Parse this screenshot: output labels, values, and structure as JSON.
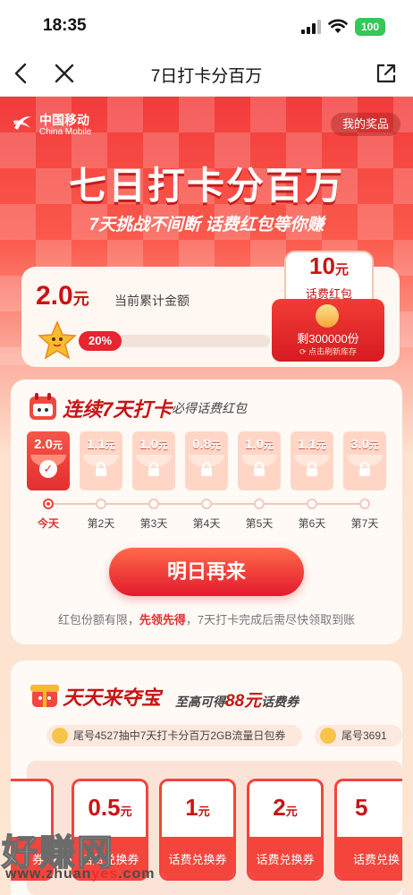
{
  "status_bar": {
    "time": "18:35",
    "battery": "100"
  },
  "nav": {
    "title": "7日打卡分百万"
  },
  "brand": {
    "cn": "中国移动",
    "en": "China Mobile"
  },
  "header": {
    "prize_link": "我的奖品",
    "title": "七日打卡分百万",
    "subtitle": "7天挑战不间断 话费红包等你赚"
  },
  "amount_card": {
    "value": "2.0",
    "unit": "元",
    "label": "当前累计金额",
    "progress_label": "20%",
    "progress_fraction": 0.2
  },
  "red_packet": {
    "value": "10",
    "unit": "元",
    "name": "话费红包",
    "remaining": "剩300000份",
    "refresh": "点击刷新库存"
  },
  "checkin": {
    "title": "连续7天打卡",
    "subtitle": "必得话费红包",
    "days": [
      {
        "value": "2.0",
        "unit": "元",
        "label": "今天",
        "done": true
      },
      {
        "value": "1.1",
        "unit": "元",
        "label": "第2天",
        "done": false
      },
      {
        "value": "1.0",
        "unit": "元",
        "label": "第3天",
        "done": false
      },
      {
        "value": "0.8",
        "unit": "元",
        "label": "第4天",
        "done": false
      },
      {
        "value": "1.0",
        "unit": "元",
        "label": "第5天",
        "done": false
      },
      {
        "value": "1.1",
        "unit": "元",
        "label": "第6天",
        "done": false
      },
      {
        "value": "3.0",
        "unit": "元",
        "label": "第7天",
        "done": false
      }
    ],
    "button": "明日再来",
    "note_prefix": "红包份额有限，",
    "note_highlight": "先领先得",
    "note_suffix": "，7天打卡完成后需尽快领取到账"
  },
  "treasure": {
    "title": "天天来夺宝",
    "subtitle_prefix": "至高可得",
    "subtitle_amount": "88元",
    "subtitle_suffix": "话费券",
    "ticker": [
      "尾号4527抽中7天打卡分百万2GB流量日包券",
      "尾号3691"
    ],
    "coupons": [
      {
        "value": "",
        "unit": "",
        "label": "券"
      },
      {
        "value": "0.5",
        "unit": "元",
        "label": "话费兑换券"
      },
      {
        "value": "1",
        "unit": "元",
        "label": "话费兑换券"
      },
      {
        "value": "2",
        "unit": "元",
        "label": "话费兑换券"
      },
      {
        "value": "5",
        "unit": "",
        "label": "话费兑换"
      }
    ]
  },
  "watermark": {
    "main": "好赚网",
    "url_prefix": "www.zhuan",
    "url_highlight": "yes",
    "url_suffix": ".com"
  },
  "colors": {
    "brand_red": "#e32f2f",
    "deep_red": "#c91414",
    "battery_green": "#34c759"
  }
}
